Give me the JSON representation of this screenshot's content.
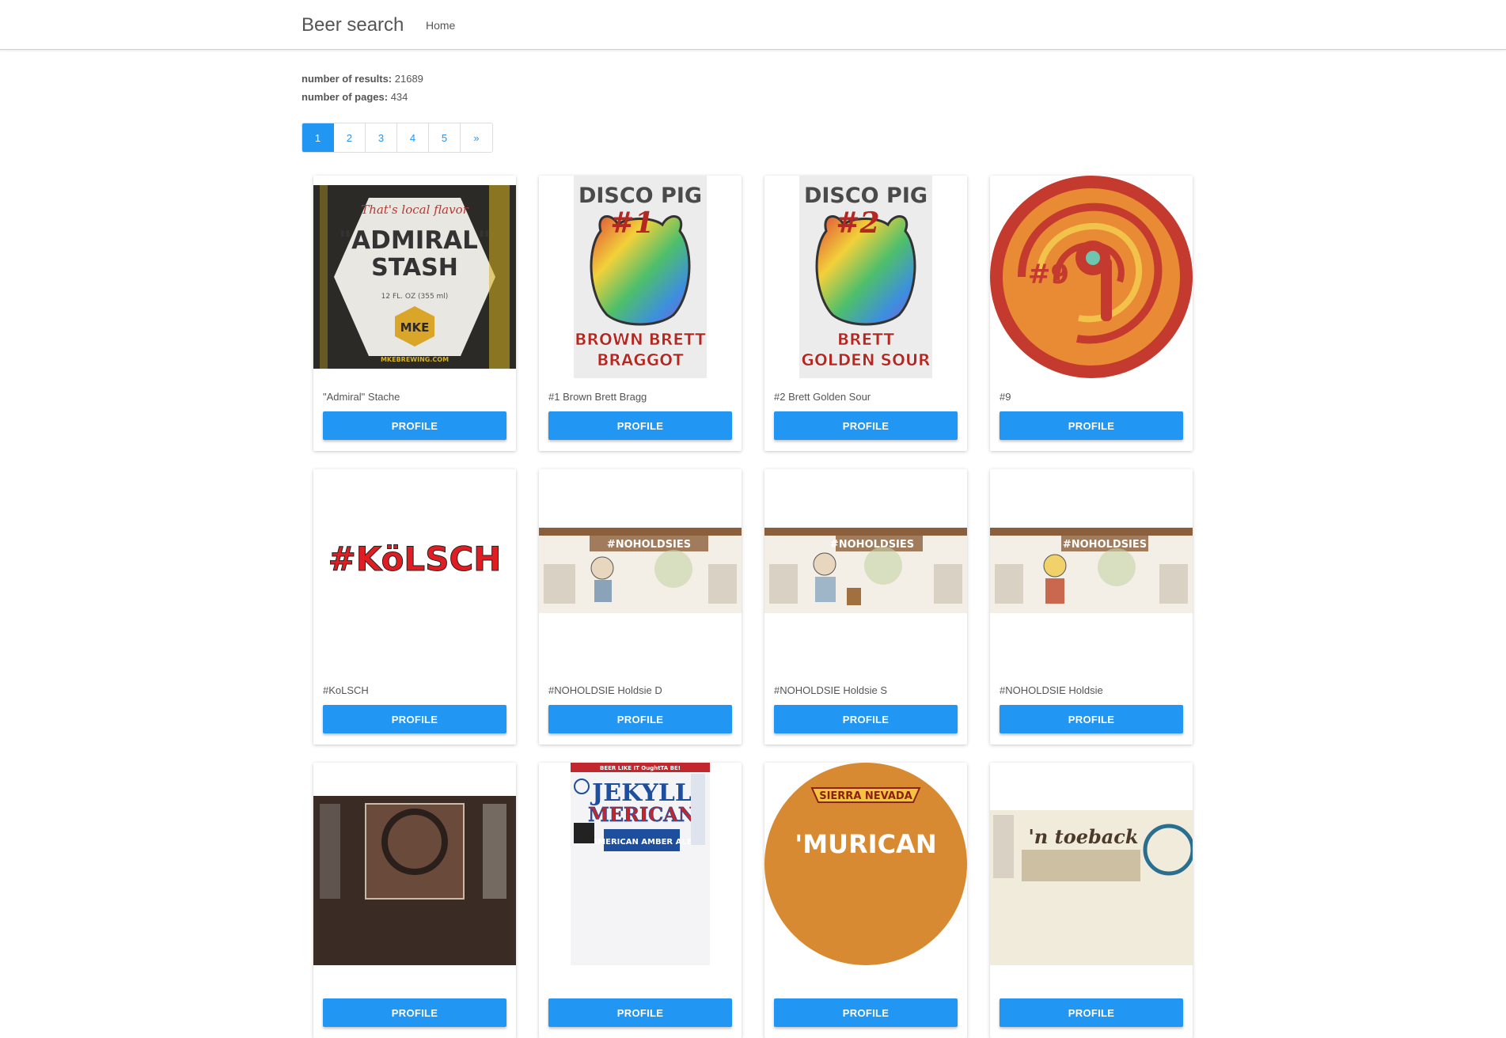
{
  "nav": {
    "brand": "Beer search",
    "home": "Home"
  },
  "stats": {
    "results_label": "number of results:",
    "results_value": "21689",
    "pages_label": "number of pages:",
    "pages_value": "434"
  },
  "pagination": {
    "pages": [
      "1",
      "2",
      "3",
      "4",
      "5",
      "»"
    ],
    "active": "1"
  },
  "profile_label": "PROFILE",
  "beers": [
    {
      "name": "\"Admiral\" Stache"
    },
    {
      "name": "#1 Brown Brett Bragg"
    },
    {
      "name": "#2 Brett Golden Sour"
    },
    {
      "name": "#9"
    },
    {
      "name": "#KoLSCH"
    },
    {
      "name": "#NOHOLDSIE Holdsie D"
    },
    {
      "name": "#NOHOLDSIE Holdsie S"
    },
    {
      "name": "#NOHOLDSIE Holdsie"
    },
    {
      "name": ""
    },
    {
      "name": ""
    },
    {
      "name": ""
    },
    {
      "name": ""
    }
  ],
  "label_text": {
    "admiral_tag": "That's local flavor",
    "admiral_main": "\"ADMIRAL\"",
    "admiral_sub": "STASH",
    "admiral_vol": "12 FL. OZ (355 ml)",
    "admiral_brand": "MKE",
    "admiral_web": "MKEBREWING.COM",
    "pig1_top": "DISCO PIG",
    "pig1_num": "#1",
    "pig1_bottom1": "BROWN BRETT",
    "pig1_bottom2": "BRAGGOT",
    "pig2_top": "DISCO PIG",
    "pig2_num": "#2",
    "pig2_bottom1": "BRETT",
    "pig2_bottom2": "GOLDEN SOUR",
    "nine": "#9",
    "kolsch": "#KöLSCH",
    "noholdsie": "#NOHOLDSIES",
    "jekyll_top": "BEER LIKE IT OughtTA BE!",
    "jekyll_brand": "JEKYLL",
    "jekyll_mid": "MERICAN",
    "jekyll_bottom": "AMERICAN AMBER ALE",
    "sierra_brand": "SIERRA NEVADA",
    "sierra_main": "'MURICAN",
    "toeback": "'n toeback"
  }
}
